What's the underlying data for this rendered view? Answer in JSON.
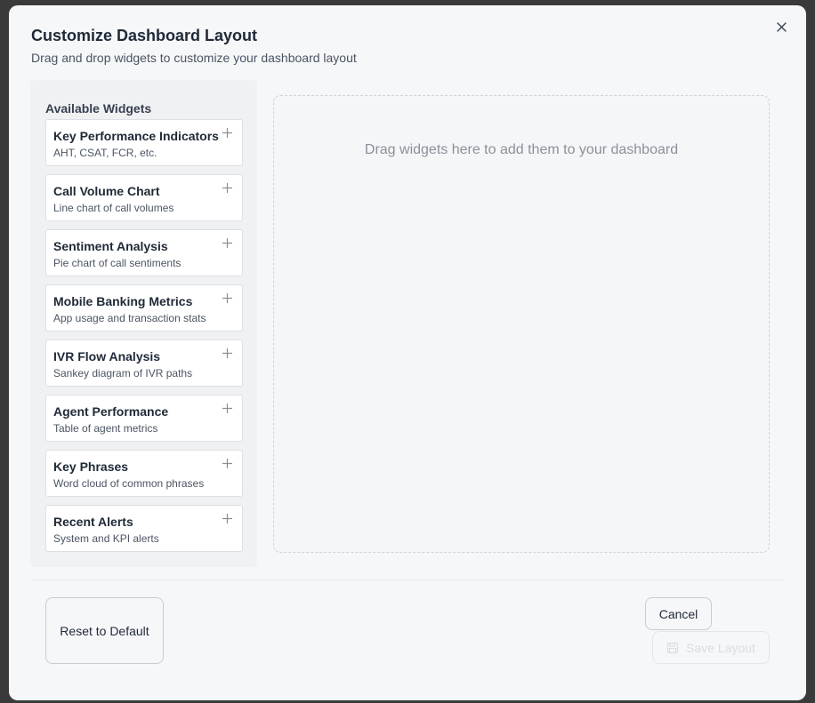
{
  "dialog": {
    "title": "Customize Dashboard Layout",
    "subtitle": "Drag and drop widgets to customize your dashboard layout",
    "close_icon": "close-icon"
  },
  "widget_panel": {
    "heading": "Available Widgets",
    "widgets": [
      {
        "name": "Key Performance Indicators",
        "description": "AHT, CSAT, FCR, etc.",
        "icon": "plus-icon"
      },
      {
        "name": "Call Volume Chart",
        "description": "Line chart of call volumes",
        "icon": "plus-icon"
      },
      {
        "name": "Sentiment Analysis",
        "description": "Pie chart of call sentiments",
        "icon": "plus-icon"
      },
      {
        "name": "Mobile Banking Metrics",
        "description": "App usage and transaction stats",
        "icon": "plus-icon"
      },
      {
        "name": "IVR Flow Analysis",
        "description": "Sankey diagram of IVR paths",
        "icon": "plus-icon"
      },
      {
        "name": "Agent Performance",
        "description": "Table of agent metrics",
        "icon": "plus-icon"
      },
      {
        "name": "Key Phrases",
        "description": "Word cloud of common phrases",
        "icon": "plus-icon"
      },
      {
        "name": "Recent Alerts",
        "description": "System and KPI alerts",
        "icon": "plus-icon"
      }
    ]
  },
  "drop_zone": {
    "hint": "Drag widgets here to add them to your dashboard"
  },
  "footer": {
    "reset_label": "Reset to Default",
    "cancel_label": "Cancel",
    "save_label": "Save Layout",
    "save_icon": "save-icon",
    "save_disabled": true
  },
  "colors": {
    "backdrop": "#3a3a3a",
    "modal_bg": "#f6f7f9",
    "panel_bg": "#f0f1f3",
    "card_bg": "#ffffff",
    "text_primary": "#1f2937",
    "text_secondary": "#4b5563",
    "hint_text": "#8b9099",
    "disabled_text": "#dadde2"
  }
}
